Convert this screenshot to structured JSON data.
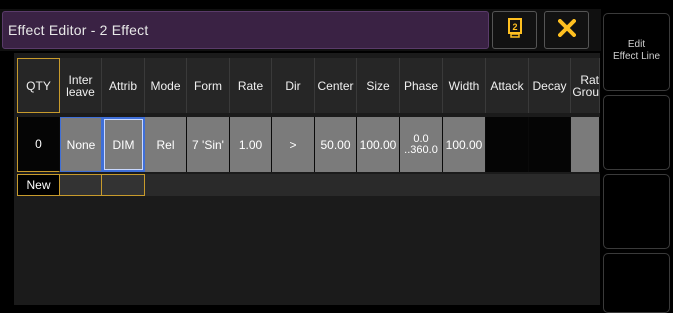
{
  "window": {
    "title": "Effect Editor - 2 Effect"
  },
  "title_buttons": {
    "sheet_icon": "sheet-icon",
    "close_icon": "close-x-icon",
    "close_color": "#ffc020"
  },
  "table": {
    "headers": {
      "qty": "QTY",
      "interleave": "Inter\nleave",
      "attrib": "Attrib",
      "mode": "Mode",
      "form": "Form",
      "rate": "Rate",
      "dir": "Dir",
      "center": "Center",
      "size": "Size",
      "phase": "Phase",
      "width": "Width",
      "attack": "Attack",
      "decay": "Decay",
      "rate_group": "Rat\nGrou"
    },
    "row": {
      "qty": "0",
      "interleave": "None",
      "attrib": "DIM",
      "mode": "Rel",
      "form": "7 'Sin'",
      "rate": "1.00",
      "dir": ">",
      "center": "50.00",
      "size": "100.00",
      "phase": "0.0\n..360.0",
      "width": "100.00",
      "attack": "",
      "decay": "",
      "rate_group": ""
    },
    "new_row_label": "New"
  },
  "side_buttons": {
    "edit_effect_line": "Edit\nEffect Line"
  },
  "colors": {
    "accent_gold": "#c89b2c",
    "selected_blue": "#3f6fd8",
    "title_purple": "#3a2244"
  }
}
